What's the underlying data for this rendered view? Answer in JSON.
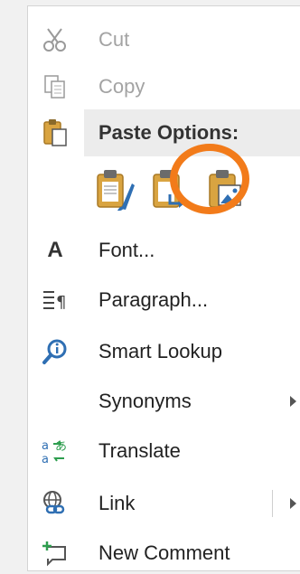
{
  "menu": {
    "cut": {
      "label": "Cut",
      "icon": "scissors-icon",
      "enabled": false
    },
    "copy": {
      "label": "Copy",
      "icon": "copy-icon",
      "enabled": false
    },
    "paste_options": {
      "label": "Paste Options:",
      "icon": "clipboard-icon",
      "options": [
        {
          "icon": "paste-keep-source-formatting-icon"
        },
        {
          "icon": "paste-merge-formatting-icon"
        },
        {
          "icon": "paste-as-picture-icon",
          "highlighted": true
        }
      ]
    },
    "font": {
      "label": "Font...",
      "icon": "font-icon"
    },
    "paragraph": {
      "label": "Paragraph...",
      "icon": "paragraph-icon"
    },
    "smart_lookup": {
      "label": "Smart Lookup",
      "icon": "smart-lookup-icon"
    },
    "synonyms": {
      "label": "Synonyms",
      "has_submenu": true
    },
    "translate": {
      "label": "Translate",
      "icon": "translate-icon"
    },
    "link": {
      "label": "Link",
      "icon": "link-icon",
      "has_submenu": true
    },
    "new_comment": {
      "label": "New Comment",
      "icon": "new-comment-icon"
    }
  },
  "colors": {
    "highlight_ring": "#f27b1a",
    "header_bg": "#ececec",
    "disabled_text": "#a3a3a3",
    "icon_blue": "#2f6fb3",
    "icon_gold": "#d9a441",
    "icon_green": "#2e9e4f"
  }
}
